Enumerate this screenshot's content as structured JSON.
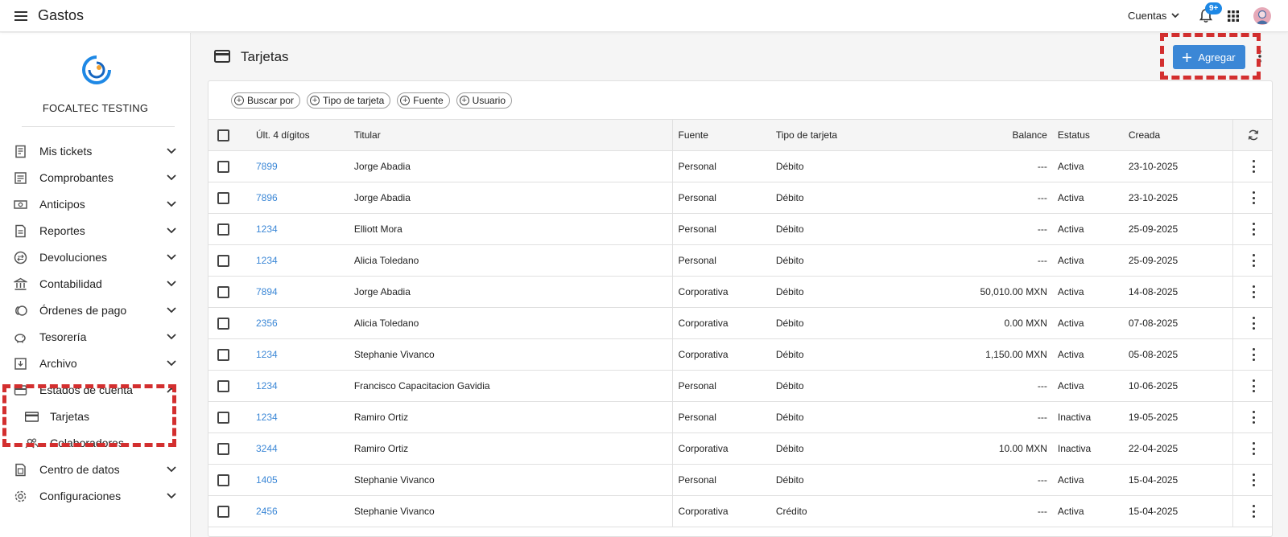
{
  "header": {
    "menu_icon": "hamburger-menu-icon",
    "app_title": "Gastos",
    "accounts_label": "Cuentas",
    "notification_count": "9+",
    "accent_color": "#1e88e5"
  },
  "sidebar": {
    "company_name": "FOCALTEC TESTING",
    "items": [
      {
        "label": "Mis tickets",
        "icon": "ticket-icon",
        "expanded": false
      },
      {
        "label": "Comprobantes",
        "icon": "receipt-icon",
        "expanded": false
      },
      {
        "label": "Anticipos",
        "icon": "money-icon",
        "expanded": false
      },
      {
        "label": "Reportes",
        "icon": "report-icon",
        "expanded": false
      },
      {
        "label": "Devoluciones",
        "icon": "refund-icon",
        "expanded": false
      },
      {
        "label": "Contabilidad",
        "icon": "bank-icon",
        "expanded": false
      },
      {
        "label": "Órdenes de pago",
        "icon": "coins-icon",
        "expanded": false
      },
      {
        "label": "Tesorería",
        "icon": "piggy-bank-icon",
        "expanded": false
      },
      {
        "label": "Archivo",
        "icon": "archive-icon",
        "expanded": false
      },
      {
        "label": "Estados de cuenta",
        "icon": "wallet-icon",
        "expanded": true
      },
      {
        "label": "Tarjetas",
        "icon": "credit-card-icon",
        "sub": true
      },
      {
        "label": "Colaboradores",
        "icon": "people-icon",
        "sub": true
      },
      {
        "label": "Centro de datos",
        "icon": "database-icon",
        "expanded": false
      },
      {
        "label": "Configuraciones",
        "icon": "gear-icon",
        "expanded": false
      }
    ]
  },
  "main": {
    "title": "Tarjetas",
    "add_button_label": "Agregar",
    "filters": [
      "Buscar por",
      "Tipo de tarjeta",
      "Fuente",
      "Usuario"
    ],
    "columns": {
      "digits": "Últ. 4 dígitos",
      "holder": "Titular",
      "source": "Fuente",
      "type": "Tipo de tarjeta",
      "balance": "Balance",
      "status": "Estatus",
      "created": "Creada"
    },
    "rows": [
      {
        "digits": "7899",
        "holder": "Jorge Abadia",
        "source": "Personal",
        "type": "Débito",
        "balance": "---",
        "status": "Activa",
        "created": "23-10-2025"
      },
      {
        "digits": "7896",
        "holder": "Jorge Abadia",
        "source": "Personal",
        "type": "Débito",
        "balance": "---",
        "status": "Activa",
        "created": "23-10-2025"
      },
      {
        "digits": "1234",
        "holder": "Elliott Mora",
        "source": "Personal",
        "type": "Débito",
        "balance": "---",
        "status": "Activa",
        "created": "25-09-2025"
      },
      {
        "digits": "1234",
        "holder": "Alicia Toledano",
        "source": "Personal",
        "type": "Débito",
        "balance": "---",
        "status": "Activa",
        "created": "25-09-2025"
      },
      {
        "digits": "7894",
        "holder": "Jorge Abadia",
        "source": "Corporativa",
        "type": "Débito",
        "balance": "50,010.00 MXN",
        "status": "Activa",
        "created": "14-08-2025"
      },
      {
        "digits": "2356",
        "holder": "Alicia Toledano",
        "source": "Corporativa",
        "type": "Débito",
        "balance": "0.00 MXN",
        "status": "Activa",
        "created": "07-08-2025"
      },
      {
        "digits": "1234",
        "holder": "Stephanie Vivanco",
        "source": "Corporativa",
        "type": "Débito",
        "balance": "1,150.00 MXN",
        "status": "Activa",
        "created": "05-08-2025"
      },
      {
        "digits": "1234",
        "holder": "Francisco Capacitacion Gavidia",
        "source": "Personal",
        "type": "Débito",
        "balance": "---",
        "status": "Activa",
        "created": "10-06-2025"
      },
      {
        "digits": "1234",
        "holder": "Ramiro Ortiz",
        "source": "Personal",
        "type": "Débito",
        "balance": "---",
        "status": "Inactiva",
        "created": "19-05-2025"
      },
      {
        "digits": "3244",
        "holder": "Ramiro Ortiz",
        "source": "Corporativa",
        "type": "Débito",
        "balance": "10.00 MXN",
        "status": "Inactiva",
        "created": "22-04-2025"
      },
      {
        "digits": "1405",
        "holder": "Stephanie Vivanco",
        "source": "Personal",
        "type": "Débito",
        "balance": "---",
        "status": "Activa",
        "created": "15-04-2025"
      },
      {
        "digits": "2456",
        "holder": "Stephanie Vivanco",
        "source": "Corporativa",
        "type": "Crédito",
        "balance": "---",
        "status": "Activa",
        "created": "15-04-2025"
      }
    ],
    "link_color": "#3b87d6",
    "button_color": "#3b87d6",
    "highlight_color": "#d32f2f"
  }
}
